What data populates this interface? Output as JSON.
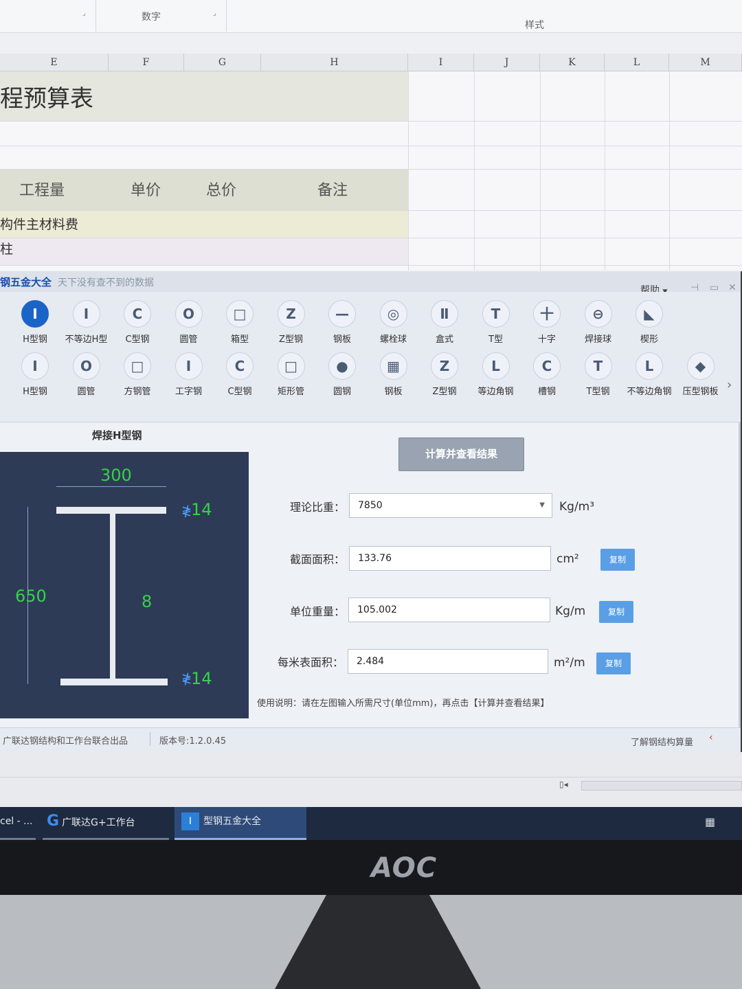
{
  "excel": {
    "ribbon_groups": [
      "数字",
      "样式"
    ],
    "columns": [
      "E",
      "F",
      "G",
      "H",
      "I",
      "J",
      "K",
      "L",
      "M"
    ],
    "sheet_title": "程预算表",
    "headers": [
      "工程量",
      "单价",
      "总价",
      "备注"
    ],
    "row1": "构件主材料费",
    "row2": "柱"
  },
  "app": {
    "title": "钢五金大全",
    "slogan": "天下没有查不到的数据",
    "help_label": "帮助",
    "toolbar_row1": [
      {
        "label": "H型钢",
        "icon": "h-beam-icon",
        "glyph": "I",
        "active": true
      },
      {
        "label": "不等边H型",
        "icon": "unequal-h-icon",
        "glyph": "I"
      },
      {
        "label": "C型钢",
        "icon": "c-channel-icon",
        "glyph": "C"
      },
      {
        "label": "圆管",
        "icon": "round-pipe-icon",
        "glyph": "O"
      },
      {
        "label": "箱型",
        "icon": "box-section-icon",
        "glyph": "□"
      },
      {
        "label": "Z型钢",
        "icon": "z-section-icon",
        "glyph": "Z"
      },
      {
        "label": "钢板",
        "icon": "steel-plate-icon",
        "glyph": "—"
      },
      {
        "label": "螺栓球",
        "icon": "bolt-ball-icon",
        "glyph": "◎"
      },
      {
        "label": "盒式",
        "icon": "box-type-icon",
        "glyph": "Ⅱ"
      },
      {
        "label": "T型",
        "icon": "t-section-icon",
        "glyph": "T"
      },
      {
        "label": "十字",
        "icon": "cross-section-icon",
        "glyph": "十"
      },
      {
        "label": "焊接球",
        "icon": "welded-ball-icon",
        "glyph": "⊖"
      },
      {
        "label": "楔形",
        "icon": "wedge-icon",
        "glyph": "◣"
      }
    ],
    "toolbar_row2": [
      {
        "label": "H型钢",
        "icon": "h-beam-icon",
        "glyph": "I"
      },
      {
        "label": "圆管",
        "icon": "round-pipe-icon",
        "glyph": "O"
      },
      {
        "label": "方钢管",
        "icon": "square-pipe-icon",
        "glyph": "□"
      },
      {
        "label": "工字钢",
        "icon": "i-beam-icon",
        "glyph": "I"
      },
      {
        "label": "C型钢",
        "icon": "c-channel-icon",
        "glyph": "C"
      },
      {
        "label": "矩形管",
        "icon": "rect-pipe-icon",
        "glyph": "□"
      },
      {
        "label": "圆钢",
        "icon": "round-bar-icon",
        "glyph": "●"
      },
      {
        "label": "钢板",
        "icon": "checker-plate-icon",
        "glyph": "▦"
      },
      {
        "label": "Z型钢",
        "icon": "z-section-icon",
        "glyph": "Z"
      },
      {
        "label": "等边角钢",
        "icon": "equal-angle-icon",
        "glyph": "L"
      },
      {
        "label": "槽钢",
        "icon": "channel-icon",
        "glyph": "C"
      },
      {
        "label": "T型钢",
        "icon": "t-section-icon",
        "glyph": "T"
      },
      {
        "label": "不等边角钢",
        "icon": "unequal-angle-icon",
        "glyph": "L"
      },
      {
        "label": "压型钢板",
        "icon": "deck-plate-icon",
        "glyph": "◆"
      }
    ],
    "section_title": "焊接H型钢",
    "diagram": {
      "width": "300",
      "height": "650",
      "flange_top": "14",
      "flange_bottom": "14",
      "web": "8"
    },
    "calc_button": "计算并查看结果",
    "fields": {
      "density": {
        "label": "理论比重：",
        "value": "7850",
        "unit": "Kg/m³"
      },
      "area": {
        "label": "截面面积：",
        "value": "133.76",
        "unit": "cm²"
      },
      "weight": {
        "label": "单位重量：",
        "value": "105.002",
        "unit": "Kg/m"
      },
      "surface": {
        "label": "每米表面积：",
        "value": "2.484",
        "unit": "m²/m"
      }
    },
    "copy_label": "复制",
    "instructions": "使用说明：请在左图输入所需尺寸(单位mm)，再点击【计算并查看结果】",
    "status_credit": "广联达钢结构和工作台联合出品",
    "status_version": "版本号:1.2.0.45",
    "status_link": "了解钢结构算量"
  },
  "taskbar": {
    "items": [
      "cel - ...",
      "广联达G+工作台",
      "型钢五金大全"
    ]
  },
  "monitor": {
    "brand": "AOC"
  },
  "colors": {
    "accent": "#1a64c8",
    "dim_green": "#37d14a",
    "diagram_bg": "#2e3b57",
    "copy_btn": "#5a9fe6"
  }
}
